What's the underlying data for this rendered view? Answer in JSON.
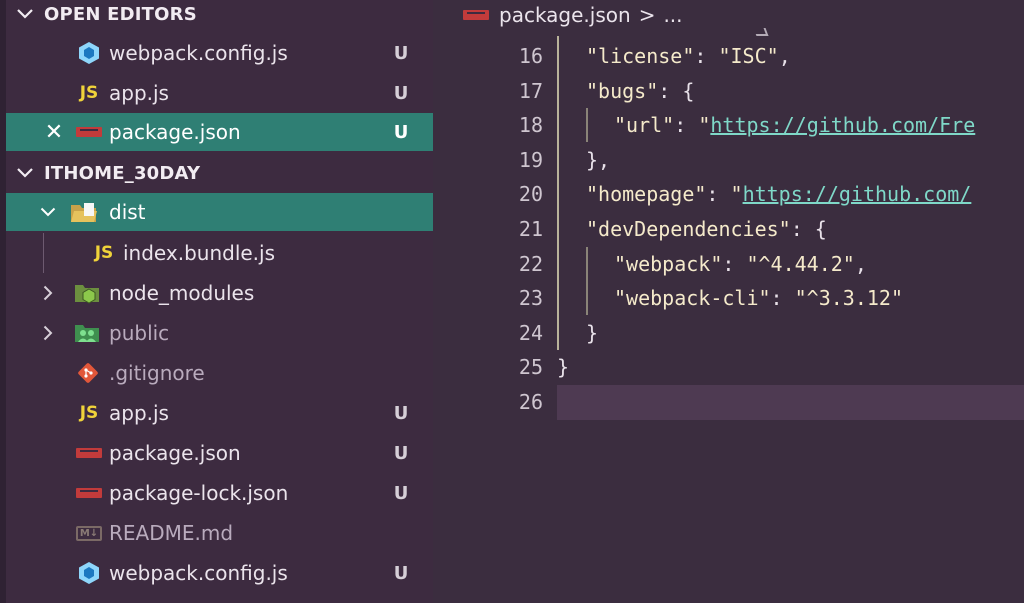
{
  "open_editors": {
    "title": "OPEN EDITORS",
    "items": [
      {
        "name": "webpack.config.js",
        "icon": "webpack-icon",
        "badge": "U"
      },
      {
        "name": "app.js",
        "icon": "js-icon",
        "badge": "U"
      },
      {
        "name": "package.json",
        "icon": "npm-icon",
        "badge": "U",
        "active": true
      }
    ]
  },
  "project": {
    "title": "ITHOME_30DAY",
    "items": [
      {
        "name": "dist",
        "icon": "folder-open-icon",
        "expanded": true,
        "active": true
      },
      {
        "name": "index.bundle.js",
        "icon": "js-icon"
      },
      {
        "name": "node_modules",
        "icon": "node-folder-icon"
      },
      {
        "name": "public",
        "icon": "public-folder-icon"
      },
      {
        "name": ".gitignore",
        "icon": "git-icon"
      },
      {
        "name": "app.js",
        "icon": "js-icon",
        "badge": "U"
      },
      {
        "name": "package.json",
        "icon": "npm-icon",
        "badge": "U"
      },
      {
        "name": "package-lock.json",
        "icon": "npm-icon",
        "badge": "U"
      },
      {
        "name": "README.md",
        "icon": "markdown-icon"
      },
      {
        "name": "webpack.config.js",
        "icon": "webpack-icon",
        "badge": "U"
      }
    ]
  },
  "labels": {
    "js": "JS",
    "md": "M↓",
    "close": "✕"
  },
  "breadcrumb": {
    "file": "package.json",
    "separator": ">",
    "more": "..."
  },
  "editor": {
    "line_numbers": [
      "16",
      "17",
      "18",
      "19",
      "20",
      "21",
      "22",
      "23",
      "24",
      "25",
      "26"
    ],
    "lines": {
      "l16": {
        "key": "\"license\"",
        "colon": ": ",
        "value": "\"ISC\"",
        "end": ","
      },
      "l17": {
        "key": "\"bugs\"",
        "colon": ": ",
        "end": "{"
      },
      "l18": {
        "key": "\"url\"",
        "colon": ": ",
        "quote": "\"",
        "url": "https://github.com/Fre"
      },
      "l19": {
        "text": "},"
      },
      "l20": {
        "key": "\"homepage\"",
        "colon": ": ",
        "quote": "\"",
        "url": "https://github.com/"
      },
      "l21": {
        "key": "\"devDependencies\"",
        "colon": ": ",
        "end": "{"
      },
      "l22": {
        "key": "\"webpack\"",
        "colon": ": ",
        "value": "\"^4.44.2\"",
        "end": ","
      },
      "l23": {
        "key": "\"webpack-cli\"",
        "colon": ": ",
        "value": "\"^3.3.12\""
      },
      "l24": {
        "text": "}"
      },
      "l25": {
        "text": "}"
      }
    }
  },
  "colors": {
    "sidebar_bg": "#3d2b40",
    "active_row": "#2f7f74",
    "editor_bg": "#3b2d3f",
    "string": "#f5eacb",
    "link": "#7fd8c8",
    "js": "#f0d33a",
    "npm": "#c23b3b",
    "webpack": "#5b9bd5"
  }
}
